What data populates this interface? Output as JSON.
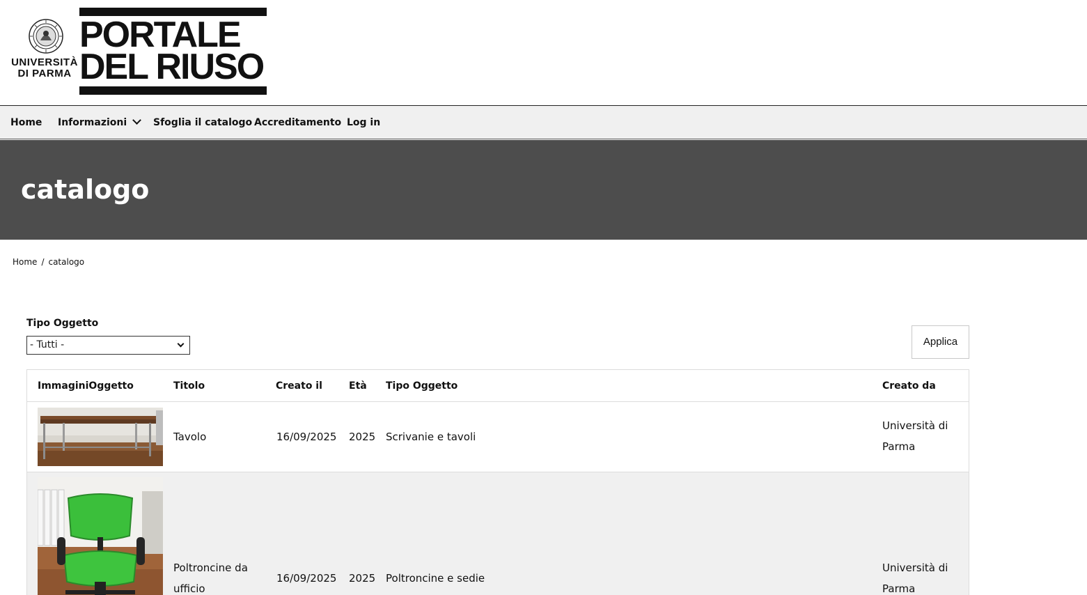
{
  "header": {
    "university": {
      "line1": "UNIVERSITÀ",
      "line2": "DI PARMA"
    },
    "portal": {
      "line1": "PORTALE",
      "line2": "DEL RIUSO"
    }
  },
  "nav": {
    "home": "Home",
    "info": "Informazioni",
    "catalog": "Sfoglia il catalogo",
    "accreditation": "Accreditamento",
    "login": "Log in"
  },
  "hero": {
    "title": "catalogo"
  },
  "breadcrumb": {
    "home": "Home",
    "separator": "/",
    "current": "catalogo"
  },
  "filter": {
    "label": "Tipo Oggetto",
    "selected": "- Tutti -",
    "apply": "Applica"
  },
  "table": {
    "columns": {
      "images": "ImmaginiOggetto",
      "title": "Titolo",
      "created": "Creato il",
      "age": "Età",
      "type": "Tipo Oggetto",
      "author": "Creato da"
    },
    "rows": [
      {
        "image": "table-photo",
        "title": "Tavolo",
        "created": "16/09/2025",
        "age": "2025",
        "type": "Scrivanie e tavoli",
        "author": "Università di Parma"
      },
      {
        "image": "green-office-chair-photo",
        "title": "Poltroncine da ufficio",
        "created": "16/09/2025",
        "age": "2025",
        "type": "Poltroncine e sedie",
        "author": "Università di Parma"
      }
    ]
  }
}
